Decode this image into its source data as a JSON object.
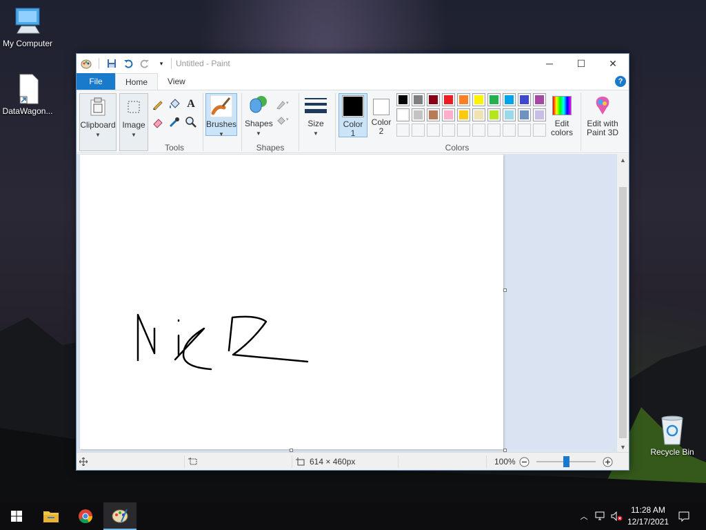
{
  "desktop": {
    "icons": [
      {
        "label": "My Computer",
        "icon": "computer-icon"
      },
      {
        "label": "DataWagon...",
        "icon": "file-shortcut-icon"
      },
      {
        "label": "Recycle Bin",
        "icon": "recycle-bin-icon"
      }
    ]
  },
  "window": {
    "title": "Untitled - Paint",
    "tabs": [
      {
        "label": "File"
      },
      {
        "label": "Home"
      },
      {
        "label": "View"
      }
    ],
    "help": "?"
  },
  "ribbon": {
    "clipboard": {
      "label": "Clipboard"
    },
    "image": {
      "label": "Image"
    },
    "tools": {
      "group_label": "Tools"
    },
    "brushes": {
      "label": "Brushes"
    },
    "shapes": {
      "label": "Shapes",
      "group_label": "Shapes"
    },
    "size": {
      "label": "Size"
    },
    "color1": {
      "label1": "Color",
      "label2": "1",
      "value": "#000000"
    },
    "color2": {
      "label1": "Color",
      "label2": "2",
      "value": "#ffffff"
    },
    "colors_group_label": "Colors",
    "edit_colors": {
      "label1": "Edit",
      "label2": "colors"
    },
    "paint3d": {
      "label1": "Edit with",
      "label2": "Paint 3D"
    },
    "palette_row1": [
      "#000000",
      "#7f7f7f",
      "#880015",
      "#ed1c24",
      "#ff7f27",
      "#fff200",
      "#22b14c",
      "#00a2e8",
      "#3f48cc",
      "#a349a4"
    ],
    "palette_row2": [
      "#ffffff",
      "#c3c3c3",
      "#b97a57",
      "#ffaec9",
      "#ffc90e",
      "#efe4b0",
      "#b5e61d",
      "#99d9ea",
      "#7092be",
      "#c8bfe7"
    ]
  },
  "status": {
    "canvas_size": "614 × 460px",
    "zoom": "100%"
  },
  "taskbar": {
    "apps": [
      "start-icon",
      "file-explorer-icon",
      "chrome-icon",
      "paint-icon"
    ],
    "time": "11:28 AM",
    "date": "12/17/2021"
  }
}
